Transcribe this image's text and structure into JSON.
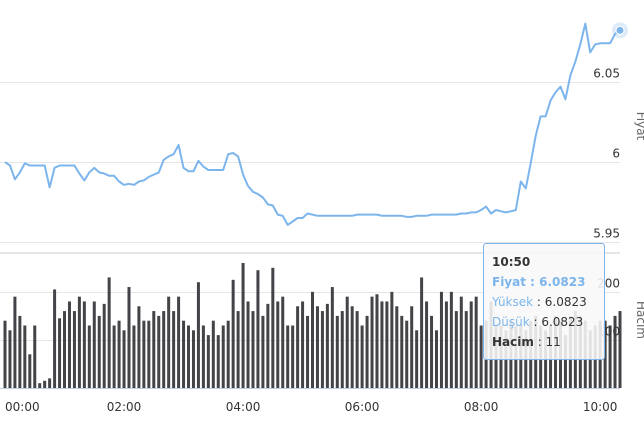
{
  "chart_data": [
    {
      "type": "line",
      "ylabel": "Fiyat",
      "yticks": [
        "6.05",
        "6",
        "5.95"
      ],
      "ytick_values": [
        6.05,
        6.0,
        5.95
      ],
      "ylim": [
        5.945,
        6.095
      ],
      "xlim": [
        0,
        620
      ],
      "grid": true,
      "color": "#7cb5ec",
      "series": [
        {
          "x": [
            0,
            5,
            10,
            15,
            20,
            25,
            30,
            35,
            40,
            45,
            50,
            55,
            60,
            65,
            70,
            75,
            80,
            85,
            90,
            95,
            100,
            105,
            110,
            115,
            120,
            125,
            130,
            135,
            140,
            145,
            150,
            155,
            160,
            165,
            170,
            175,
            180,
            185,
            190,
            195,
            200,
            205,
            210,
            215,
            220,
            225,
            230,
            235,
            240,
            245,
            250,
            255,
            260,
            265,
            270,
            275,
            280,
            285,
            290,
            295,
            300,
            305,
            310,
            315,
            320,
            325,
            330,
            335,
            340,
            345,
            350,
            355,
            360,
            365,
            370,
            375,
            380,
            385,
            390,
            395,
            400,
            405,
            410,
            415,
            420,
            425,
            430,
            435,
            440,
            445,
            450,
            455,
            460,
            465,
            470,
            475,
            480,
            485,
            490,
            495,
            500,
            505,
            510,
            515,
            520,
            525,
            530,
            535,
            540,
            545,
            550,
            555,
            560,
            565,
            570,
            575,
            580,
            585,
            590,
            595,
            600,
            605,
            610,
            615,
            620
          ],
          "y": [
            5.9999,
            5.9978,
            5.9892,
            5.9935,
            5.9992,
            5.9978,
            5.9978,
            5.9978,
            5.9978,
            5.9842,
            5.9964,
            5.9978,
            5.9978,
            5.9978,
            5.9978,
            5.9928,
            5.9885,
            5.9935,
            5.9964,
            5.9935,
            5.9928,
            5.9914,
            5.9914,
            5.9878,
            5.9857,
            5.9864,
            5.9857,
            5.9878,
            5.9885,
            5.9907,
            5.9921,
            5.9935,
            6.0014,
            6.0035,
            6.0049,
            6.0106,
            5.9964,
            5.9942,
            5.9942,
            6.0007,
            5.9971,
            5.995,
            5.995,
            5.995,
            5.995,
            6.0049,
            6.0056,
            6.0035,
            5.9921,
            5.985,
            5.9814,
            5.98,
            5.9778,
            5.9735,
            5.9728,
            5.9671,
            5.9664,
            5.9607,
            5.9628,
            5.965,
            5.965,
            5.9678,
            5.9671,
            5.9664,
            5.9664,
            5.9664,
            5.9664,
            5.9664,
            5.9664,
            5.9664,
            5.9664,
            5.9671,
            5.9671,
            5.9671,
            5.9671,
            5.9671,
            5.9664,
            5.9664,
            5.9664,
            5.9664,
            5.9664,
            5.9657,
            5.9657,
            5.9664,
            5.9664,
            5.9664,
            5.9671,
            5.9671,
            5.9671,
            5.9671,
            5.9671,
            5.9671,
            5.9678,
            5.9678,
            5.9685,
            5.9685,
            5.97,
            5.9721,
            5.9678,
            5.97,
            5.9692,
            5.9685,
            5.9692,
            5.97,
            5.9878,
            5.9835,
            5.9992,
            6.0164,
            6.0285,
            6.0285,
            6.0385,
            6.0435,
            6.0471,
            6.0392,
            6.0542,
            6.0628,
            6.0735,
            6.0865,
            6.0685,
            6.0735,
            6.0742,
            6.0742,
            6.0742,
            6.08,
            6.0823
          ]
        }
      ]
    },
    {
      "type": "bar",
      "ylabel": "Hacim",
      "yticks": [
        "200",
        "100"
      ],
      "ytick_values": [
        200,
        100
      ],
      "ylim": [
        0,
        260
      ],
      "xticks": [
        "00:00",
        "02:00",
        "04:00",
        "06:00",
        "08:00",
        "10:00"
      ],
      "xtick_positions": [
        0,
        120,
        240,
        360,
        480,
        600
      ],
      "color": "#434348",
      "series": [
        {
          "x": [
            0,
            5,
            10,
            15,
            20,
            25,
            30,
            35,
            40,
            45,
            50,
            55,
            60,
            65,
            70,
            75,
            80,
            85,
            90,
            95,
            100,
            105,
            110,
            115,
            120,
            125,
            130,
            135,
            140,
            145,
            150,
            155,
            160,
            165,
            170,
            175,
            180,
            185,
            190,
            195,
            200,
            205,
            210,
            215,
            220,
            225,
            230,
            235,
            240,
            245,
            250,
            255,
            260,
            265,
            270,
            275,
            280,
            285,
            290,
            295,
            300,
            305,
            310,
            315,
            320,
            325,
            330,
            335,
            340,
            345,
            350,
            355,
            360,
            365,
            370,
            375,
            380,
            385,
            390,
            395,
            400,
            405,
            410,
            415,
            420,
            425,
            430,
            435,
            440,
            445,
            450,
            455,
            460,
            465,
            470,
            475,
            480,
            485,
            490,
            495,
            500,
            505,
            510,
            515,
            520,
            525,
            530,
            535,
            540,
            545,
            550,
            555,
            560,
            565,
            570,
            575,
            580,
            585,
            590,
            595,
            600,
            605,
            610,
            615,
            620
          ],
          "values": [
            140,
            120,
            190,
            150,
            130,
            70,
            130,
            10,
            15,
            20,
            205,
            145,
            160,
            180,
            160,
            190,
            180,
            130,
            180,
            150,
            175,
            230,
            130,
            140,
            120,
            210,
            130,
            170,
            140,
            140,
            160,
            150,
            160,
            190,
            160,
            190,
            140,
            130,
            120,
            220,
            130,
            110,
            140,
            110,
            130,
            140,
            225,
            160,
            260,
            180,
            160,
            245,
            150,
            175,
            250,
            180,
            190,
            130,
            130,
            170,
            180,
            150,
            200,
            170,
            160,
            175,
            210,
            150,
            160,
            190,
            170,
            160,
            130,
            150,
            190,
            195,
            180,
            180,
            200,
            170,
            150,
            140,
            170,
            120,
            230,
            180,
            150,
            120,
            200,
            180,
            200,
            160,
            190,
            160,
            180,
            190,
            130,
            140,
            180,
            130,
            130,
            120,
            140,
            130,
            130,
            120,
            140,
            150,
            130,
            120,
            130,
            150,
            140,
            110,
            150,
            160,
            150,
            140,
            120,
            130,
            140,
            140,
            130,
            150,
            160
          ]
        }
      ]
    }
  ],
  "tooltip": {
    "time": "10:50",
    "price_label": "Fiyat : 6.0823",
    "high_label": "Yüksek",
    "high_value": " : 6.0823",
    "low_label": "Düşük",
    "low_value": " : 6.0823",
    "volume_label": "Hacim",
    "volume_value": " : 11"
  }
}
